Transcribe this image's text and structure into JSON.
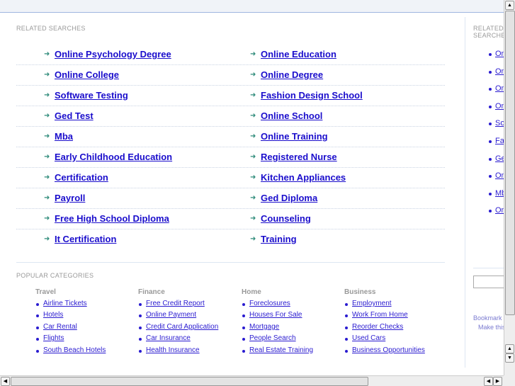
{
  "related_label": "RELATED SEARCHES",
  "related_left": [
    "Online Psychology Degree",
    "Online College",
    "Software Testing",
    "Ged Test",
    "Mba",
    "Early Childhood Education",
    "Certification",
    "Payroll",
    "Free High School Diploma",
    "It Certification"
  ],
  "related_right": [
    "Online Education",
    "Online Degree",
    "Fashion Design School",
    "Online School",
    "Online Training",
    "Registered Nurse",
    "Kitchen Appliances",
    "Ged Diploma",
    "Counseling",
    "Training"
  ],
  "popular_label": "POPULAR CATEGORIES",
  "categories": [
    {
      "title": "Travel",
      "items": [
        "Airline Tickets",
        "Hotels",
        "Car Rental",
        "Flights",
        "South Beach Hotels"
      ]
    },
    {
      "title": "Finance",
      "items": [
        "Free Credit Report",
        "Online Payment",
        "Credit Card Application",
        "Car Insurance",
        "Health Insurance"
      ]
    },
    {
      "title": "Home",
      "items": [
        "Foreclosures",
        "Houses For Sale",
        "Mortgage",
        "People Search",
        "Real Estate Training"
      ]
    },
    {
      "title": "Business",
      "items": [
        "Employment",
        "Work From Home",
        "Reorder Checks",
        "Used Cars",
        "Business Opportunities"
      ]
    }
  ],
  "sidebar": {
    "label": "RELATED SEARCHES",
    "items": [
      "Online Psychology Degree",
      "Online College",
      "Online Education",
      "Online Degree",
      "Software Testing",
      "Fashion Design School",
      "Ged Test",
      "Online School",
      "Mba",
      "Online Training"
    ],
    "bookmark": "Bookmark this page",
    "homepage": "Make this your homepage"
  }
}
